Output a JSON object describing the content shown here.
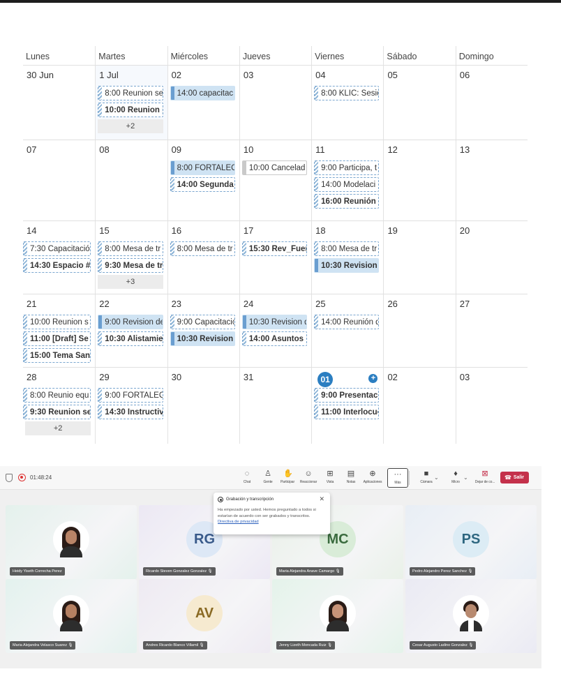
{
  "calendar": {
    "weekdays": [
      "Lunes",
      "Martes",
      "Miércoles",
      "Jueves",
      "Viernes",
      "Sábado",
      "Domingo"
    ],
    "weeks": [
      {
        "days": [
          {
            "num": "30 Jun",
            "events": []
          },
          {
            "num": "1 Jul",
            "highlight": true,
            "events": [
              {
                "t": "8:00 Reunion se",
                "s": "dash"
              },
              {
                "t": "10:00 Reunion p",
                "s": "dash",
                "b": true
              }
            ],
            "more": "+2"
          },
          {
            "num": "02",
            "events": [
              {
                "t": "14:00 capacitac",
                "s": "solid"
              }
            ]
          },
          {
            "num": "03",
            "events": []
          },
          {
            "num": "04",
            "events": [
              {
                "t": "8:00 KLIC: Sesió",
                "s": "dash"
              }
            ]
          },
          {
            "num": "05",
            "events": []
          },
          {
            "num": "06",
            "events": []
          }
        ]
      },
      {
        "days": [
          {
            "num": "07",
            "events": []
          },
          {
            "num": "08",
            "events": []
          },
          {
            "num": "09",
            "events": [
              {
                "t": "8:00 FORTALECI",
                "s": "solid"
              },
              {
                "t": "14:00 Segunda",
                "s": "dash",
                "b": true
              }
            ]
          },
          {
            "num": "10",
            "events": [
              {
                "t": "10:00 Cancelad",
                "s": "plain"
              }
            ]
          },
          {
            "num": "11",
            "events": [
              {
                "t": "9:00 Participa, t",
                "s": "dash"
              },
              {
                "t": "14:00 Modelaci",
                "s": "dash"
              },
              {
                "t": "16:00 Reunión p",
                "s": "dash",
                "b": true
              }
            ]
          },
          {
            "num": "12",
            "events": []
          },
          {
            "num": "13",
            "events": []
          }
        ]
      },
      {
        "days": [
          {
            "num": "14",
            "events": [
              {
                "t": "7:30 Capacitació",
                "s": "dash"
              },
              {
                "t": "14:30 Espacio #",
                "s": "dash",
                "b": true
              }
            ]
          },
          {
            "num": "15",
            "events": [
              {
                "t": "8:00 Mesa de tr",
                "s": "dash"
              },
              {
                "t": "9:30 Mesa de tr",
                "s": "dash",
                "b": true
              }
            ],
            "more": "+3"
          },
          {
            "num": "16",
            "events": [
              {
                "t": "8:00 Mesa de tr",
                "s": "dash"
              }
            ]
          },
          {
            "num": "17",
            "events": [
              {
                "t": "15:30 Rev_Fuen",
                "s": "dash",
                "b": true
              }
            ]
          },
          {
            "num": "18",
            "events": [
              {
                "t": "8:00 Mesa de tr",
                "s": "dash"
              },
              {
                "t": "10:30 Revision d",
                "s": "solid",
                "b": true
              }
            ]
          },
          {
            "num": "19",
            "events": []
          },
          {
            "num": "20",
            "events": []
          }
        ]
      },
      {
        "days": [
          {
            "num": "21",
            "events": [
              {
                "t": "10:00 Reunion s",
                "s": "dash"
              },
              {
                "t": "11:00 [Draft] Se",
                "s": "dash",
                "b": true
              },
              {
                "t": "15:00 Tema San",
                "s": "dash",
                "b": true
              }
            ]
          },
          {
            "num": "22",
            "events": [
              {
                "t": "9:00 Revision de",
                "s": "solid"
              },
              {
                "t": "10:30 Alistamie",
                "s": "dash",
                "b": true
              }
            ]
          },
          {
            "num": "23",
            "events": [
              {
                "t": "9:00 Capacitació",
                "s": "dash"
              },
              {
                "t": "10:30 Revision d",
                "s": "solid",
                "b": true
              }
            ]
          },
          {
            "num": "24",
            "events": [
              {
                "t": "10:30 Revision d",
                "s": "solid"
              },
              {
                "t": "14:00 Asuntos F",
                "s": "dash",
                "b": true
              }
            ]
          },
          {
            "num": "25",
            "events": [
              {
                "t": "14:00 Reunión d",
                "s": "dash"
              }
            ]
          },
          {
            "num": "26",
            "events": []
          },
          {
            "num": "27",
            "events": []
          }
        ]
      },
      {
        "days": [
          {
            "num": "28",
            "events": [
              {
                "t": "8:00 Reunio equ",
                "s": "dash"
              },
              {
                "t": "9:30 Reunion se",
                "s": "dash",
                "b": true
              }
            ],
            "more": "+2"
          },
          {
            "num": "29",
            "events": [
              {
                "t": "9:00 FORTALECI",
                "s": "dash"
              },
              {
                "t": "14:30 Instructiv",
                "s": "dash",
                "b": true
              }
            ]
          },
          {
            "num": "30",
            "events": []
          },
          {
            "num": "31",
            "events": []
          },
          {
            "num": "01",
            "today": true,
            "events": [
              {
                "t": "9:00 Presentació",
                "s": "dash",
                "b": true
              },
              {
                "t": "11:00 Interlocuc",
                "s": "dash",
                "b": true
              }
            ]
          },
          {
            "num": "02",
            "events": []
          },
          {
            "num": "03",
            "events": []
          }
        ]
      }
    ],
    "today_plus": "+"
  },
  "meeting": {
    "timer": "01:48:24",
    "toolbar": [
      {
        "label": "Chat",
        "icon": "chat-icon",
        "glyph": "◌"
      },
      {
        "label": "Gente",
        "icon": "people-icon",
        "glyph": "♙"
      },
      {
        "label": "Participar",
        "icon": "raise-hand-icon",
        "glyph": "✋"
      },
      {
        "label": "Reaccionar",
        "icon": "react-icon",
        "glyph": "☺"
      },
      {
        "label": "Vista",
        "icon": "view-icon",
        "glyph": "⊞"
      },
      {
        "label": "Notas",
        "icon": "notes-icon",
        "glyph": "▤"
      },
      {
        "label": "Aplicaciones",
        "icon": "apps-icon",
        "glyph": "⊕"
      },
      {
        "label": "Más",
        "icon": "more-icon",
        "glyph": "···"
      }
    ],
    "controls": [
      {
        "label": "Cámara",
        "icon": "camera-off-icon",
        "glyph": "■"
      },
      {
        "label": "Micro",
        "icon": "mic-icon",
        "glyph": "♦"
      },
      {
        "label": "Dejar de co...",
        "icon": "stop-share-icon",
        "glyph": "⊠"
      }
    ],
    "leave_label": "Salir",
    "popup": {
      "title": "Grabación y transcripción",
      "body": "Ha empezado por usted. Hemos preguntado a todos si estarían de acuerdo con ser grabados y transcritos.",
      "link": "Directiva de privacidad"
    },
    "participants": [
      {
        "name": "Heidy Yiseth Correcha Perez",
        "type": "photo",
        "skin": "#b98467",
        "bg": "#e4f1ec"
      },
      {
        "name": "Ricardo Steven Gonzalez Gonzalez",
        "type": "initials",
        "initials": "RG",
        "circle": "#dde8f6",
        "color": "#395a8a",
        "bg": "#ece8f4"
      },
      {
        "name": "Maria Alejandra Anave Camargo",
        "type": "initials",
        "initials": "MC",
        "circle": "#d9ecd8",
        "color": "#3a6b3e",
        "bg": "#e9f1e8"
      },
      {
        "name": "Pedro Alejandro Perez Sanchez",
        "type": "initials",
        "initials": "PS",
        "circle": "#dcecf5",
        "color": "#2e6780",
        "bg": "#e8eef5"
      },
      {
        "name": "Maria Alejandra Velasco Suarez",
        "type": "photo",
        "skin": "#b58062",
        "bg": "#e3f2ee"
      },
      {
        "name": "Andres Ricardo Blanco Villamil",
        "type": "initials",
        "initials": "AV",
        "circle": "#f6ead0",
        "color": "#8a6a24",
        "bg": "#eeeaf2"
      },
      {
        "name": "Jenny Lizeth Moncada Ruiz",
        "type": "photo",
        "skin": "#c79378",
        "bg": "#e4f3ea"
      },
      {
        "name": "Cesar Augusto Ladino Gonzalez",
        "type": "photo",
        "skin": "#b88a70",
        "bg": "#eaeaf3",
        "male": true
      }
    ]
  }
}
